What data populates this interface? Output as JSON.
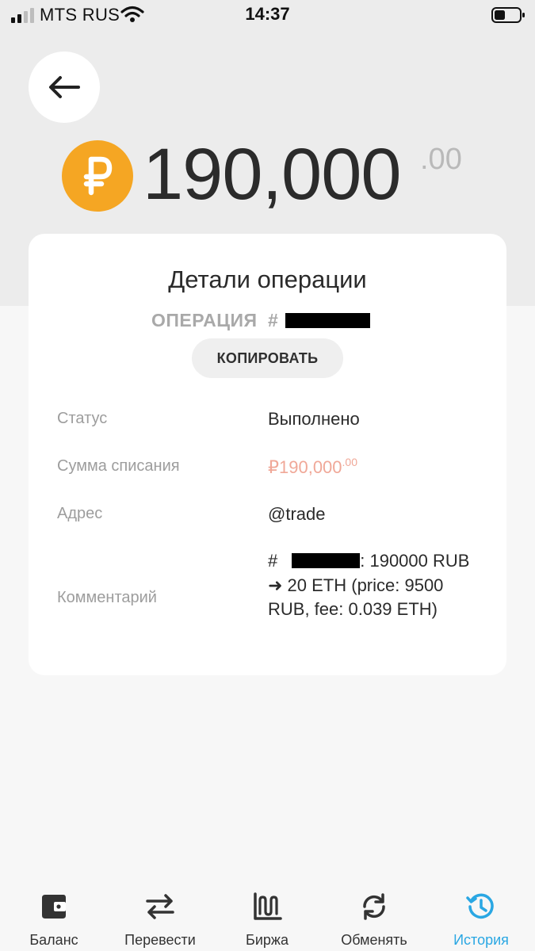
{
  "status_bar": {
    "carrier": "MTS RUS",
    "time": "14:37"
  },
  "amount": {
    "value": "190,000",
    "decimals": ".00",
    "coin_icon": "ruble-coin-icon",
    "coin_color": "#f5a623"
  },
  "details": {
    "title": "Детали операции",
    "operation_label": "ОПЕРАЦИЯ",
    "operation_hash": "#",
    "copy_label": "КОПИРОВАТЬ",
    "status_label": "Статус",
    "status_value": "Выполнено",
    "debit_label": "Сумма списания",
    "debit_value": "₽190,000",
    "debit_decimals": ".00",
    "address_label": "Адрес",
    "address_value": "@trade",
    "comment_label": "Комментарий",
    "comment_hash": "#",
    "comment_text": ": 190000 RUB ➜ 20 ETH (price: 9500 RUB, fee: 0.039 ETH)"
  },
  "nav": {
    "items": [
      {
        "label": "Баланс",
        "icon": "wallet-icon"
      },
      {
        "label": "Перевести",
        "icon": "transfer-arrows-icon"
      },
      {
        "label": "Биржа",
        "icon": "exchange-chart-icon"
      },
      {
        "label": "Обменять",
        "icon": "refresh-icon"
      },
      {
        "label": "История",
        "icon": "history-icon",
        "active": true
      }
    ],
    "active_color": "#2aa7e3"
  }
}
